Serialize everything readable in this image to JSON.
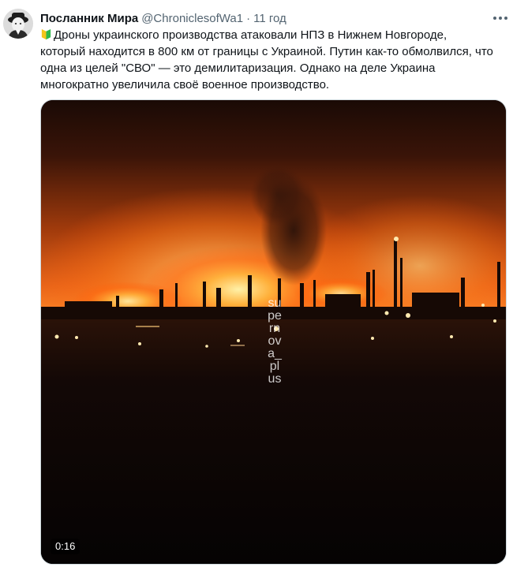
{
  "tweet": {
    "author": {
      "display_name": "Посланник Мира",
      "handle": "@ChroniclesofWa1",
      "separator": "·",
      "timestamp": "11 год",
      "avatar_icon": "avatar-portrait"
    },
    "more_icon": "ellipsis-icon",
    "text": {
      "emoji_icon": "beginner-shield-emoji-icon",
      "line1": "Дроны украинского производства атаковали НПЗ в Нижнем Новгороде,",
      "line2": "который находится в 800 км от границы с Украиной. Путин как-то обмолвился, что",
      "line3": "одна из целей \"СВО\" — это демилитаризация. Однако на деле Украина",
      "line4": "многократно увеличила своё военное производство."
    },
    "media": {
      "type": "video",
      "watermark": "supernova_plus",
      "duration": "0:16"
    }
  },
  "colors": {
    "text_primary": "#0f1419",
    "text_secondary": "#536471",
    "border": "#cfd9de",
    "fire_orange": "#ff7a1a"
  }
}
